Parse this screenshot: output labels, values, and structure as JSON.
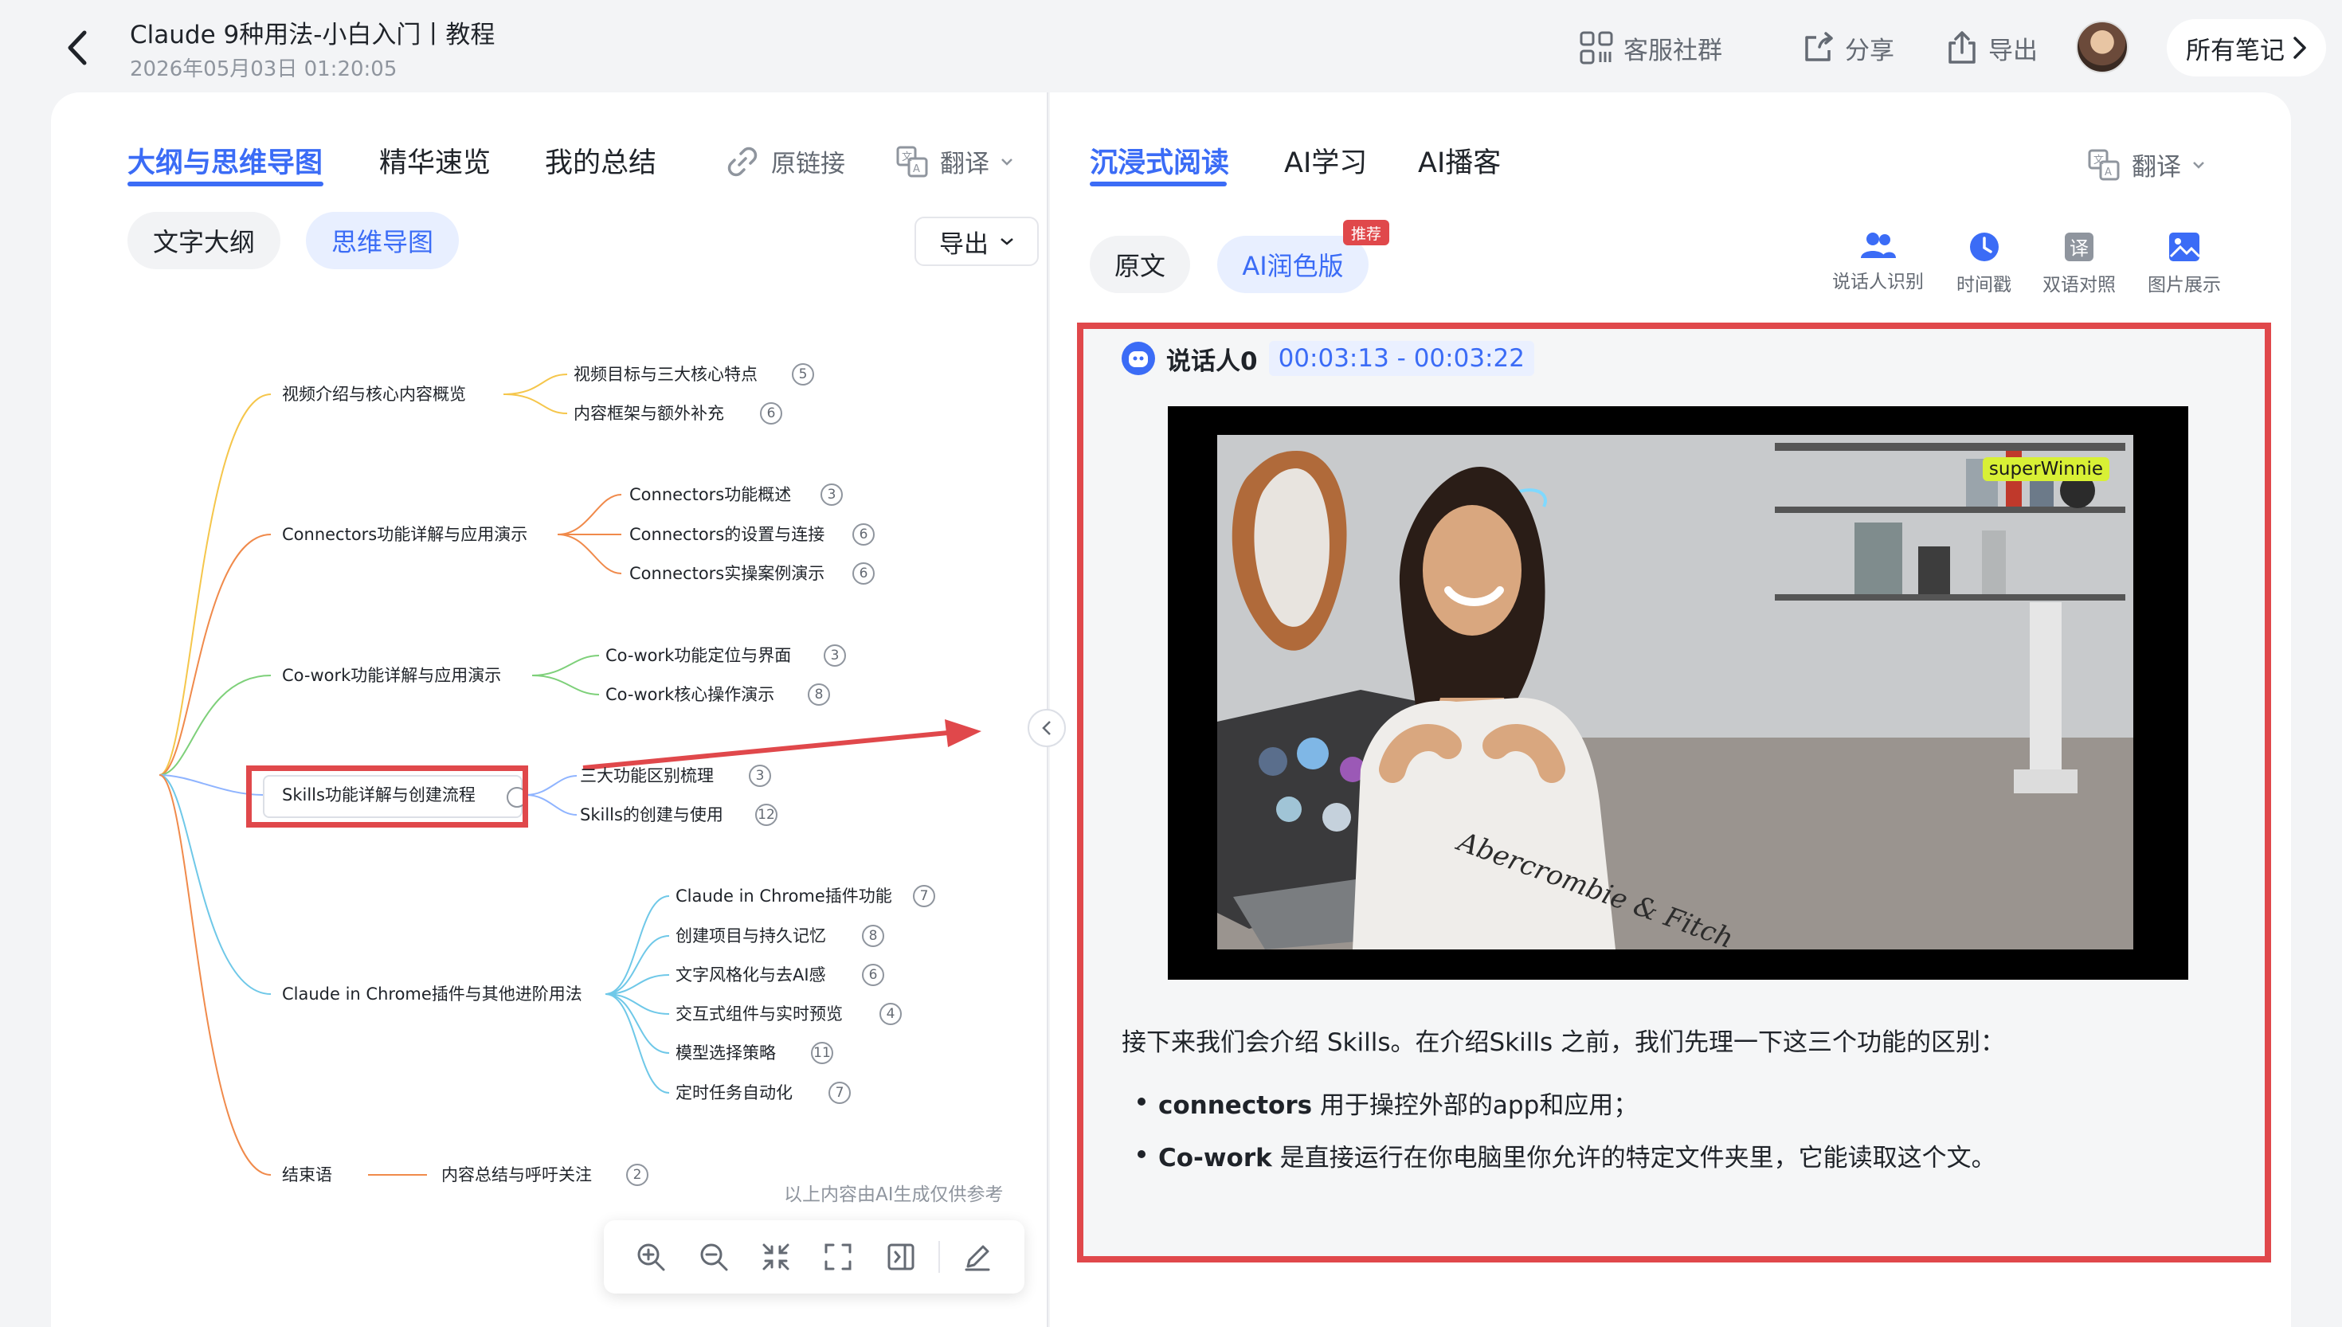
{
  "header": {
    "title": "Claude 9种用法-小白入门丨教程",
    "datetime": "2026年05月03日 01:20:05",
    "actions": {
      "community": "客服社群",
      "share": "分享",
      "export": "导出"
    },
    "all_notes": "所有笔记"
  },
  "left": {
    "tabs": [
      "大纲与思维导图",
      "精华速览",
      "我的总结"
    ],
    "source_link": "原链接",
    "translate": "翻译",
    "view_toggle": [
      "文字大纲",
      "思维导图"
    ],
    "export": "导出",
    "mindmap": {
      "branches": [
        {
          "label": "视频介绍与核心内容概览",
          "children": [
            {
              "label": "视频目标与三大核心特点",
              "count": "5"
            },
            {
              "label": "内容框架与额外补充",
              "count": "6"
            }
          ]
        },
        {
          "label": "Connectors功能详解与应用演示",
          "children": [
            {
              "label": "Connectors功能概述",
              "count": "3"
            },
            {
              "label": "Connectors的设置与连接",
              "count": "6"
            },
            {
              "label": "Connectors实操案例演示",
              "count": "6"
            }
          ]
        },
        {
          "label": "Co-work功能详解与应用演示",
          "children": [
            {
              "label": "Co-work功能定位与界面",
              "count": "3"
            },
            {
              "label": "Co-work核心操作演示",
              "count": "8"
            }
          ]
        },
        {
          "label": "Skills功能详解与创建流程",
          "children": [
            {
              "label": "三大功能区别梳理",
              "count": "3"
            },
            {
              "label": "Skills的创建与使用",
              "count": "12"
            }
          ]
        },
        {
          "label": "Claude in Chrome插件与其他进阶用法",
          "children": [
            {
              "label": "Claude in Chrome插件功能",
              "count": "7"
            },
            {
              "label": "创建项目与持久记忆",
              "count": "8"
            },
            {
              "label": "文字风格化与去AI感",
              "count": "6"
            },
            {
              "label": "交互式组件与实时预览",
              "count": "4"
            },
            {
              "label": "模型选择策略",
              "count": "11"
            },
            {
              "label": "定时任务自动化",
              "count": "7"
            }
          ]
        },
        {
          "label": "结束语",
          "children": [
            {
              "label": "内容总结与呼吁关注",
              "count": "2"
            }
          ]
        }
      ]
    },
    "ai_note": "以上内容由AI生成仅供参考"
  },
  "right": {
    "tabs": [
      "沉浸式阅读",
      "AI学习",
      "AI播客"
    ],
    "translate": "翻译",
    "view_toggle": [
      "原文",
      "AI润色版"
    ],
    "recommend_badge": "推荐",
    "tools": [
      "说话人识别",
      "时间戳",
      "双语对照",
      "图片展示"
    ],
    "speaker": "说话人0",
    "timestamp": "00:03:13 - 00:03:22",
    "video_watermark": "superWinnie",
    "video_shirt_text": "Abercrombie & Fitch",
    "paragraph": "接下来我们会介绍 Skills。在介绍Skills 之前，我们先理一下这三个功能的区别：",
    "bullets": [
      {
        "term": "connectors",
        "text": "用于操控外部的app和应用；"
      },
      {
        "term": "Co-work",
        "text": "是直接运行在你电脑里你允许的特定文件夹里，它能读取这个文。"
      }
    ]
  },
  "colors": {
    "accent": "#3b6cf6",
    "highlight_red": "#e0484b",
    "branch_colors": [
      "#f5c64b",
      "#f08a4b",
      "#7ed07a",
      "#8fb4ff",
      "#6fc8e8",
      "#f08a4b"
    ]
  }
}
